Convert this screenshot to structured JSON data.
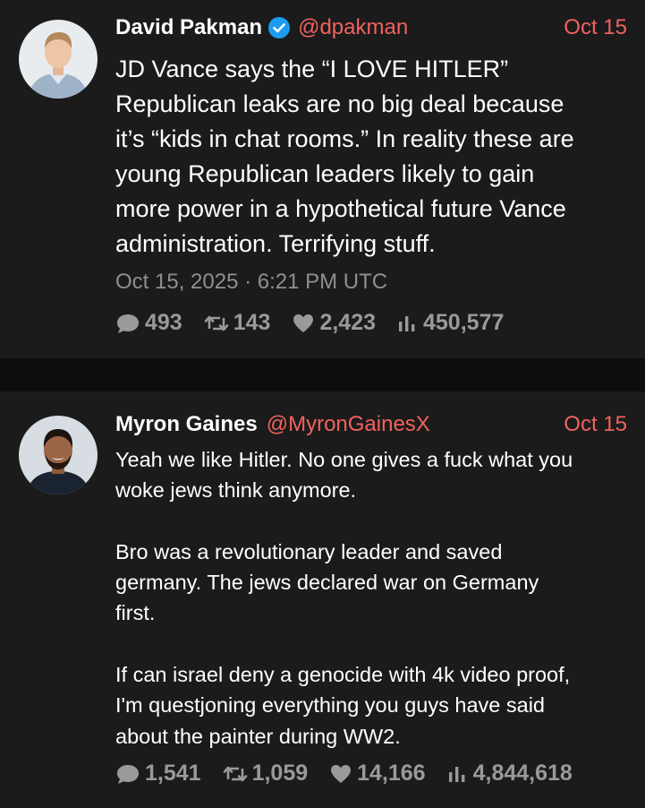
{
  "posts": [
    {
      "author": {
        "display_name": "David Pakman",
        "handle": "@dpakman",
        "verified": true
      },
      "date_short": "Oct 15",
      "text": "JD Vance says the “I LOVE HITLER”\nRepublican leaks are no big deal because\nit’s “kids in chat rooms.” In reality these are\nyoung Republican leaders likely to gain\nmore power in a hypothetical future Vance\nadministration. Terrifying stuff.",
      "timestamp": "Oct 15, 2025 · 6:21 PM UTC",
      "stats": {
        "replies": "493",
        "reposts": "143",
        "likes": "2,423",
        "views": "450,577"
      }
    },
    {
      "author": {
        "display_name": "Myron Gaines",
        "handle": "@MyronGainesX",
        "verified": false
      },
      "date_short": "Oct 15",
      "text": "Yeah we like Hitler. No one gives a fuck what you\nwoke jews think anymore.\n\nBro was a revolutionary leader and saved\ngermany. The jews declared war on Germany\nfirst.\n\nIf can israel deny a genocide with 4k video proof,\nI'm questjoning everything you guys have said\nabout the painter during WW2.",
      "stats": {
        "replies": "1,541",
        "reposts": "1,059",
        "likes": "14,166",
        "views": "4,844,618"
      }
    }
  ],
  "colors": {
    "background": "#0d0d0d",
    "card": "#1b1b1b",
    "accent": "#f0625f",
    "muted": "#8f8f8f",
    "verified_badge": "#1d9bf0"
  },
  "icons": [
    "comment-icon",
    "repost-icon",
    "heart-icon",
    "views-icon",
    "verified-badge-icon"
  ]
}
